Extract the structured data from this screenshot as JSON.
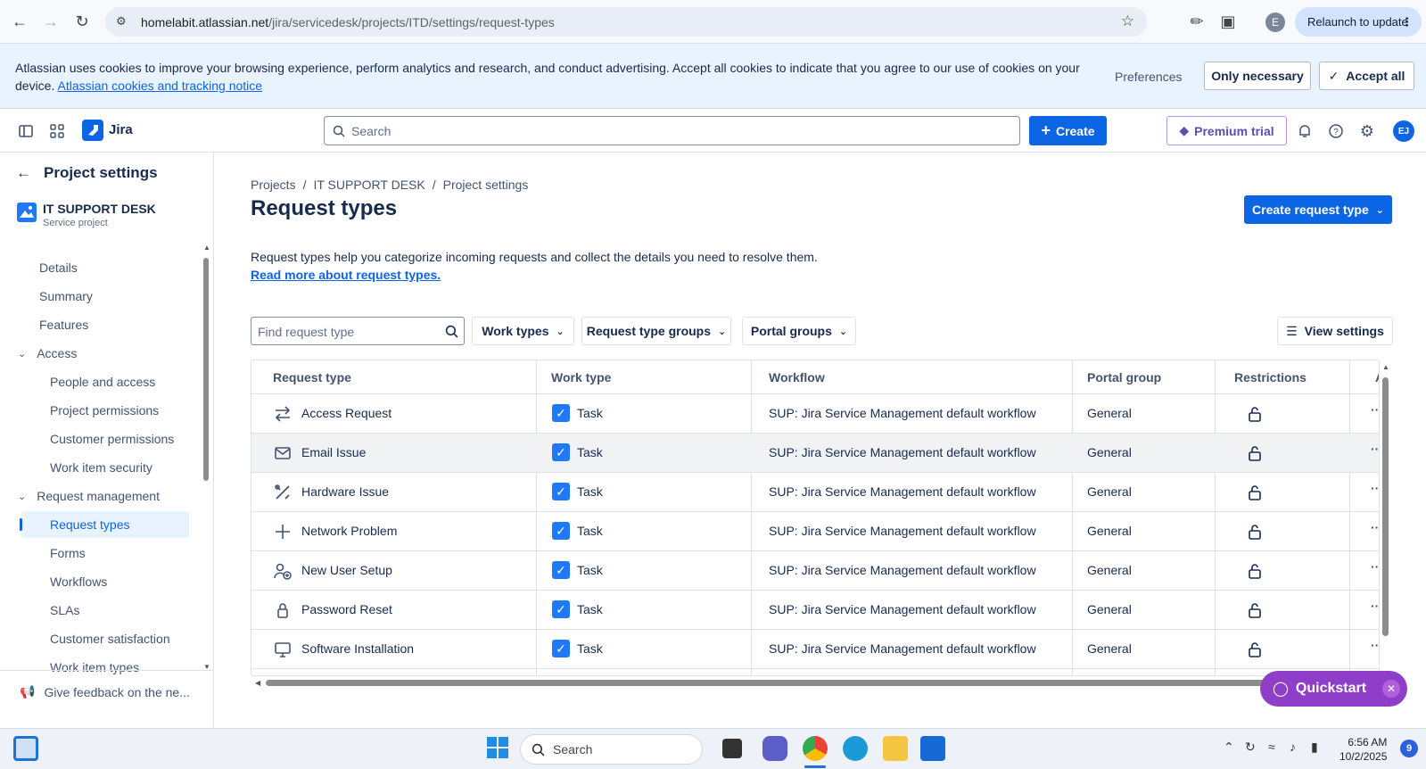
{
  "browser": {
    "url_host": "homelabit.atlassian.net",
    "url_path": "/jira/servicedesk/projects/ITD/settings/request-types",
    "profile_initial": "E",
    "relaunch_label": "Relaunch to update"
  },
  "cookie_banner": {
    "message": "Atlassian uses cookies to improve your browsing experience, perform analytics and research, and conduct advertising. Accept all cookies to indicate that you agree to our use of cookies on your device.",
    "link_text": "Atlassian cookies and tracking notice",
    "preferences_label": "Preferences",
    "only_necessary_label": "Only necessary",
    "accept_all_label": "Accept all"
  },
  "topnav": {
    "app_name": "Jira",
    "search_placeholder": "Search",
    "create_label": "Create",
    "premium_label": "Premium trial",
    "avatar_initials": "EJ"
  },
  "sidebar": {
    "back_label": "Project settings",
    "project_name": "IT SUPPORT DESK",
    "project_type": "Service project",
    "items": [
      {
        "label": "Details"
      },
      {
        "label": "Summary"
      },
      {
        "label": "Features"
      },
      {
        "label": "Access"
      },
      {
        "label": "People and access"
      },
      {
        "label": "Project permissions"
      },
      {
        "label": "Customer permissions"
      },
      {
        "label": "Work item security"
      },
      {
        "label": "Request management"
      },
      {
        "label": "Request types"
      },
      {
        "label": "Forms"
      },
      {
        "label": "Workflows"
      },
      {
        "label": "SLAs"
      },
      {
        "label": "Customer satisfaction"
      },
      {
        "label": "Work item types"
      }
    ],
    "feedback_label": "Give feedback on the ne..."
  },
  "main": {
    "breadcrumb": [
      "Projects",
      "IT SUPPORT DESK",
      "Project settings"
    ],
    "title": "Request types",
    "create_request_type_label": "Create request type",
    "description": "Request types help you categorize incoming requests and collect the details you need to resolve them.",
    "read_more_link": "Read more about request types.",
    "find_placeholder": "Find request type",
    "filters": {
      "work_types": "Work types",
      "request_type_groups": "Request type groups",
      "portal_groups": "Portal groups",
      "view_settings": "View settings"
    }
  },
  "table": {
    "headers": [
      "Request type",
      "Work type",
      "Workflow",
      "Portal group",
      "Restrictions",
      "A"
    ],
    "rows": [
      {
        "name": "Access Request",
        "icon": "arrows-swap-icon",
        "work_type": "Task",
        "workflow": "SUP: Jira Service Management default workflow",
        "portal_group": "General"
      },
      {
        "name": "Email Issue",
        "icon": "envelope-icon",
        "work_type": "Task",
        "workflow": "SUP: Jira Service Management default workflow",
        "portal_group": "General"
      },
      {
        "name": "Hardware Issue",
        "icon": "tools-icon",
        "work_type": "Task",
        "workflow": "SUP: Jira Service Management default workflow",
        "portal_group": "General"
      },
      {
        "name": "Network Problem",
        "icon": "plus-icon",
        "work_type": "Task",
        "workflow": "SUP: Jira Service Management default workflow",
        "portal_group": "General"
      },
      {
        "name": "New User Setup",
        "icon": "user-add-icon",
        "work_type": "Task",
        "workflow": "SUP: Jira Service Management default workflow",
        "portal_group": "General"
      },
      {
        "name": "Password Reset",
        "icon": "lock-icon",
        "work_type": "Task",
        "workflow": "SUP: Jira Service Management default workflow",
        "portal_group": "General"
      },
      {
        "name": "Software Installation",
        "icon": "monitor-icon",
        "work_type": "Task",
        "workflow": "SUP: Jira Service Management default workflow",
        "portal_group": "General"
      }
    ]
  },
  "quickstart": {
    "label": "Quickstart"
  },
  "taskbar": {
    "search_label": "Search",
    "time": "6:56 AM",
    "date": "10/2/2025",
    "notification_count": "9"
  },
  "colors": {
    "primary": "#0c66e4",
    "quickstart": "#8f3ec8",
    "cookie_bg": "#e9f2ff"
  }
}
